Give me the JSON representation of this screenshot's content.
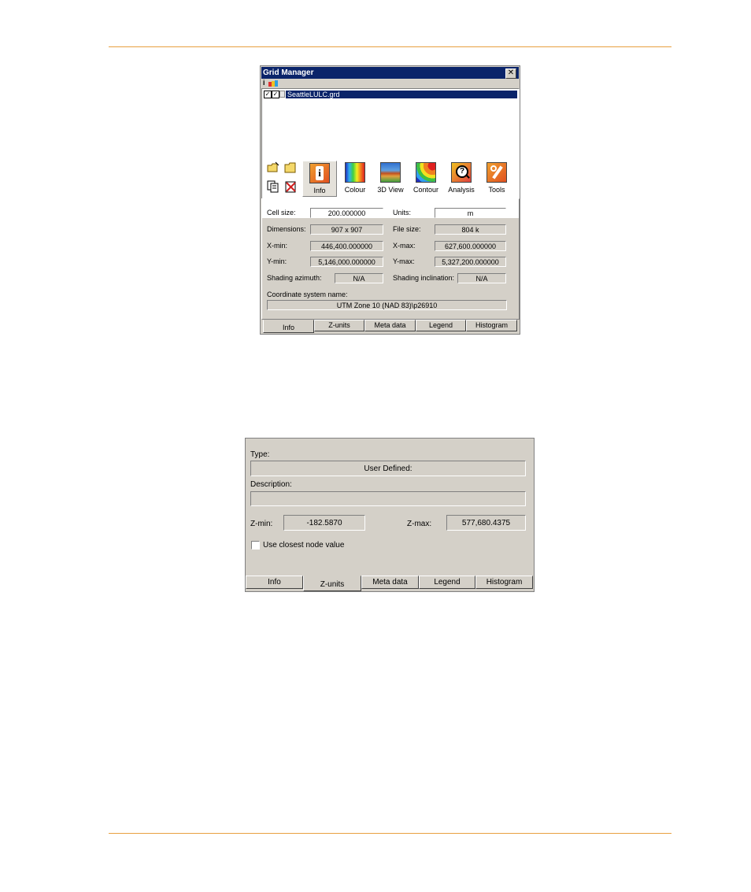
{
  "grid_manager": {
    "title": "Grid Manager",
    "close_glyph": "✕",
    "file_item": "SeattleLULC.grd",
    "tools": [
      {
        "label": "Info",
        "icon": "info-icon"
      },
      {
        "label": "Colour",
        "icon": "colour-icon"
      },
      {
        "label": "3D View",
        "icon": "3d-view-icon"
      },
      {
        "label": "Contour",
        "icon": "contour-icon"
      },
      {
        "label": "Analysis",
        "icon": "analysis-icon"
      },
      {
        "label": "Tools",
        "icon": "tools-icon"
      }
    ],
    "info": {
      "cell_size_label": "Cell size:",
      "cell_size": "200.000000",
      "units_label": "Units:",
      "units": "m",
      "dimensions_label": "Dimensions:",
      "dimensions": "907 x 907",
      "file_size_label": "File size:",
      "file_size": "804 k",
      "xmin_label": "X-min:",
      "xmin": "446,400.000000",
      "xmax_label": "X-max:",
      "xmax": "627,600.000000",
      "ymin_label": "Y-min:",
      "ymin": "5,146,000.000000",
      "ymax_label": "Y-max:",
      "ymax": "5,327,200.000000",
      "shading_azimuth_label": "Shading azimuth:",
      "shading_azimuth": "N/A",
      "shading_inclination_label": "Shading inclination:",
      "shading_inclination": "N/A",
      "coord_label": "Coordinate system name:",
      "coord": "UTM Zone 10 (NAD 83)\\p26910"
    },
    "tabs": [
      "Info",
      "Z-units",
      "Meta data",
      "Legend",
      "Histogram"
    ],
    "active_tab": "Info"
  },
  "zunits_panel": {
    "type_label": "Type:",
    "type_value": "User Defined:",
    "description_label": "Description:",
    "description_value": "",
    "zmin_label": "Z-min:",
    "zmin": "-182.5870",
    "zmax_label": "Z-max:",
    "zmax": "577,680.4375",
    "closest_node_label": "Use closest node value",
    "closest_node_checked": false,
    "tabs": [
      "Info",
      "Z-units",
      "Meta data",
      "Legend",
      "Histogram"
    ],
    "active_tab": "Z-units"
  },
  "colors": {
    "rule": "#e8a040",
    "titlebar": "#0a246a",
    "face": "#d4d0c8"
  }
}
